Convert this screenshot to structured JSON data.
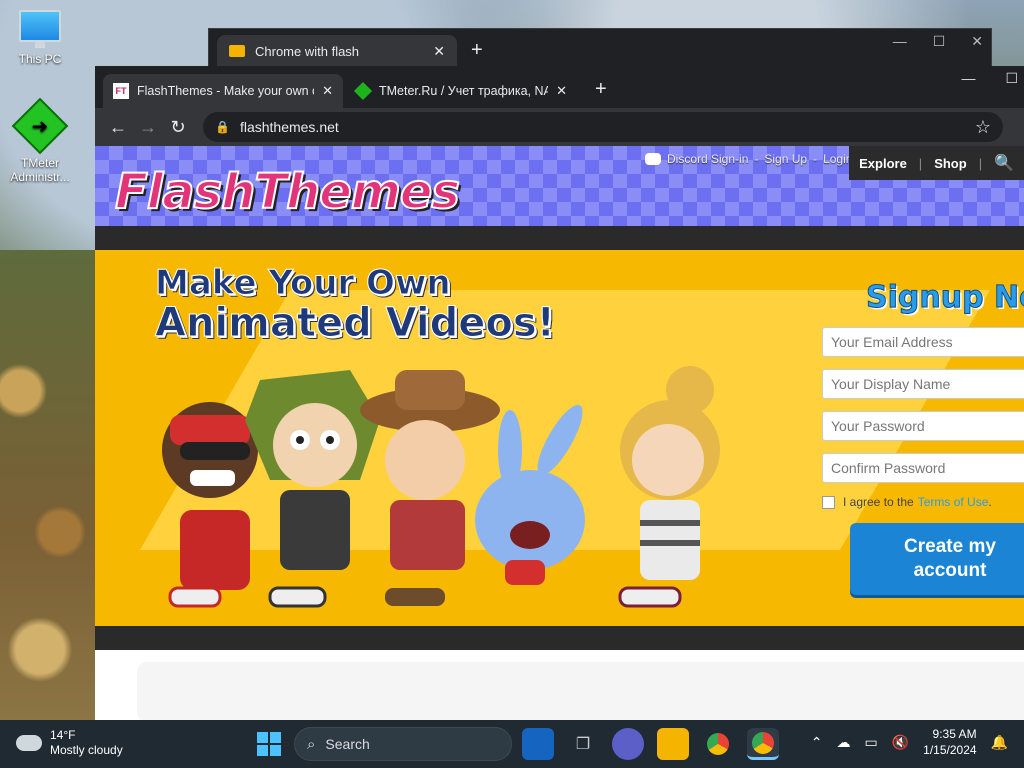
{
  "desktop": {
    "icons": [
      {
        "label": "This PC"
      },
      {
        "label": "TMeter Administr..."
      }
    ]
  },
  "back_window": {
    "tab_title": "Chrome with flash"
  },
  "browser": {
    "tabs": [
      {
        "title": "FlashThemes - Make your own ca",
        "favicon_text": "FT"
      },
      {
        "title": "TMeter.Ru / Учет трафика, NAT,"
      }
    ],
    "url": "flashthemes.net"
  },
  "site": {
    "logo": "FlashThemes",
    "auth": {
      "discord": "Discord Sign-in",
      "sep1": "-",
      "signup": "Sign Up",
      "sep2": "-",
      "login": "Login"
    },
    "nav": {
      "explore": "Explore",
      "shop": "Shop"
    },
    "hero": {
      "line1": "Make Your Own",
      "line2": "Animated Videos!"
    },
    "signup": {
      "title": "Signup Now",
      "email_placeholder": "Your Email Address",
      "name_placeholder": "Your Display Name",
      "password_placeholder": "Your Password",
      "confirm_placeholder": "Confirm Password",
      "agree_text": "I agree to the",
      "terms_link": "Terms of Use",
      "agree_end": ".",
      "cta": "Create my account"
    }
  },
  "taskbar": {
    "weather_temp": "14°F",
    "weather_desc": "Mostly cloudy",
    "search_label": "Search",
    "time": "9:35 AM",
    "date": "1/15/2024"
  },
  "colors": {
    "hero_bg": "#f6b800",
    "cta_bg": "#1b84d4",
    "header_checker": "#6c6ff0",
    "taskbar_bg": "#1f2a33"
  }
}
